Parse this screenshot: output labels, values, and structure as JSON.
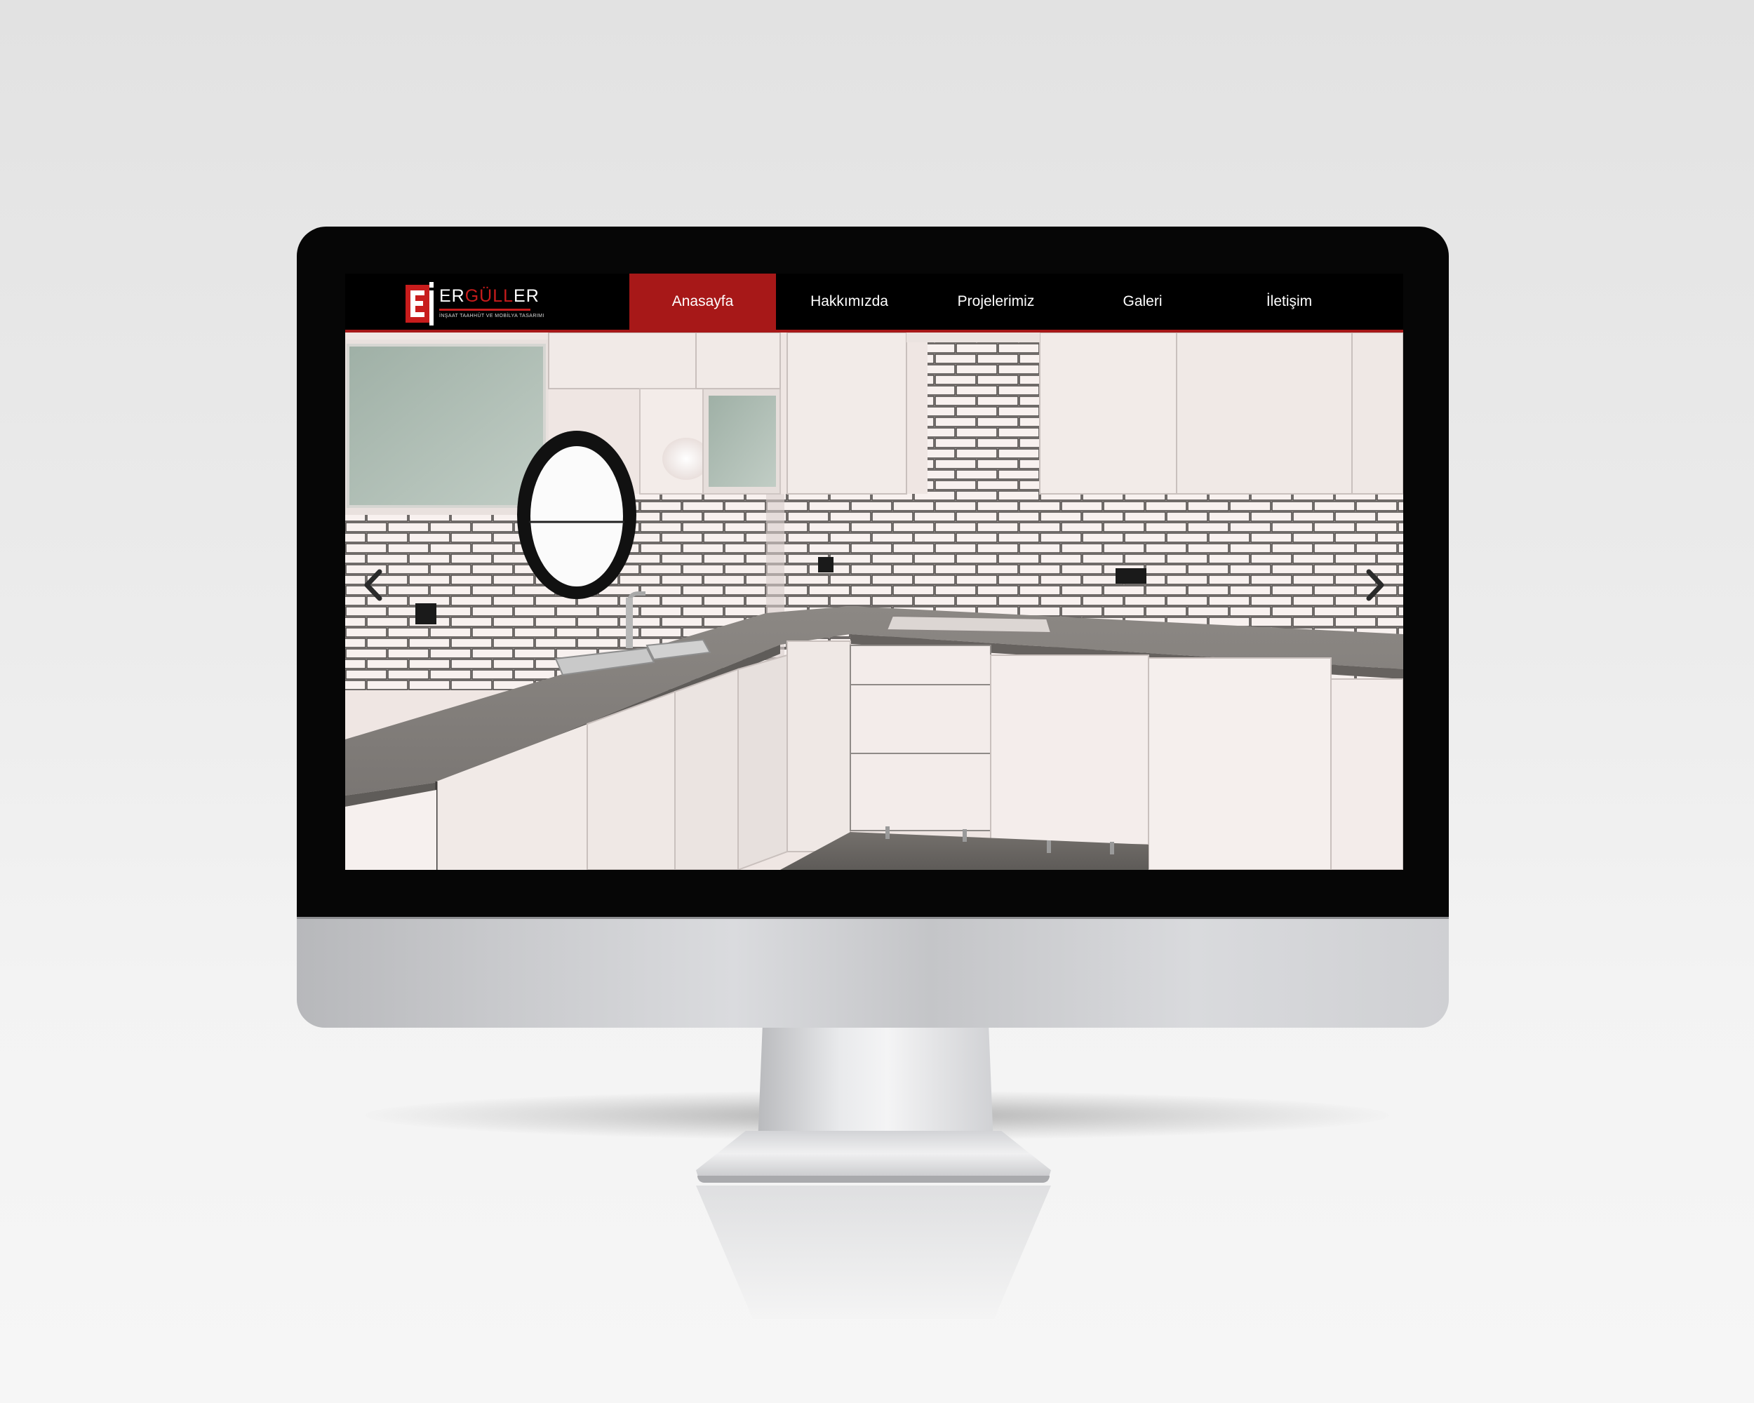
{
  "brand": {
    "logo_initial": "E",
    "name_part1": "ER",
    "name_part2": "GÜLL",
    "name_part3": "ER",
    "tagline": "İNŞAAT TAAHHÜT VE MOBİLYA TASARIMI"
  },
  "nav": {
    "items": [
      {
        "label": "Anasayfa",
        "active": true
      },
      {
        "label": "Hakkımızda",
        "active": false
      },
      {
        "label": "Projelerimiz",
        "active": false
      },
      {
        "label": "Galeri",
        "active": false
      },
      {
        "label": "İletişim",
        "active": false
      }
    ]
  },
  "slider": {
    "prev_icon": "chevron-left-icon",
    "next_icon": "chevron-right-icon"
  },
  "colors": {
    "accent": "#a71818",
    "header_bg": "#000000",
    "nav_text": "#ffffff"
  }
}
